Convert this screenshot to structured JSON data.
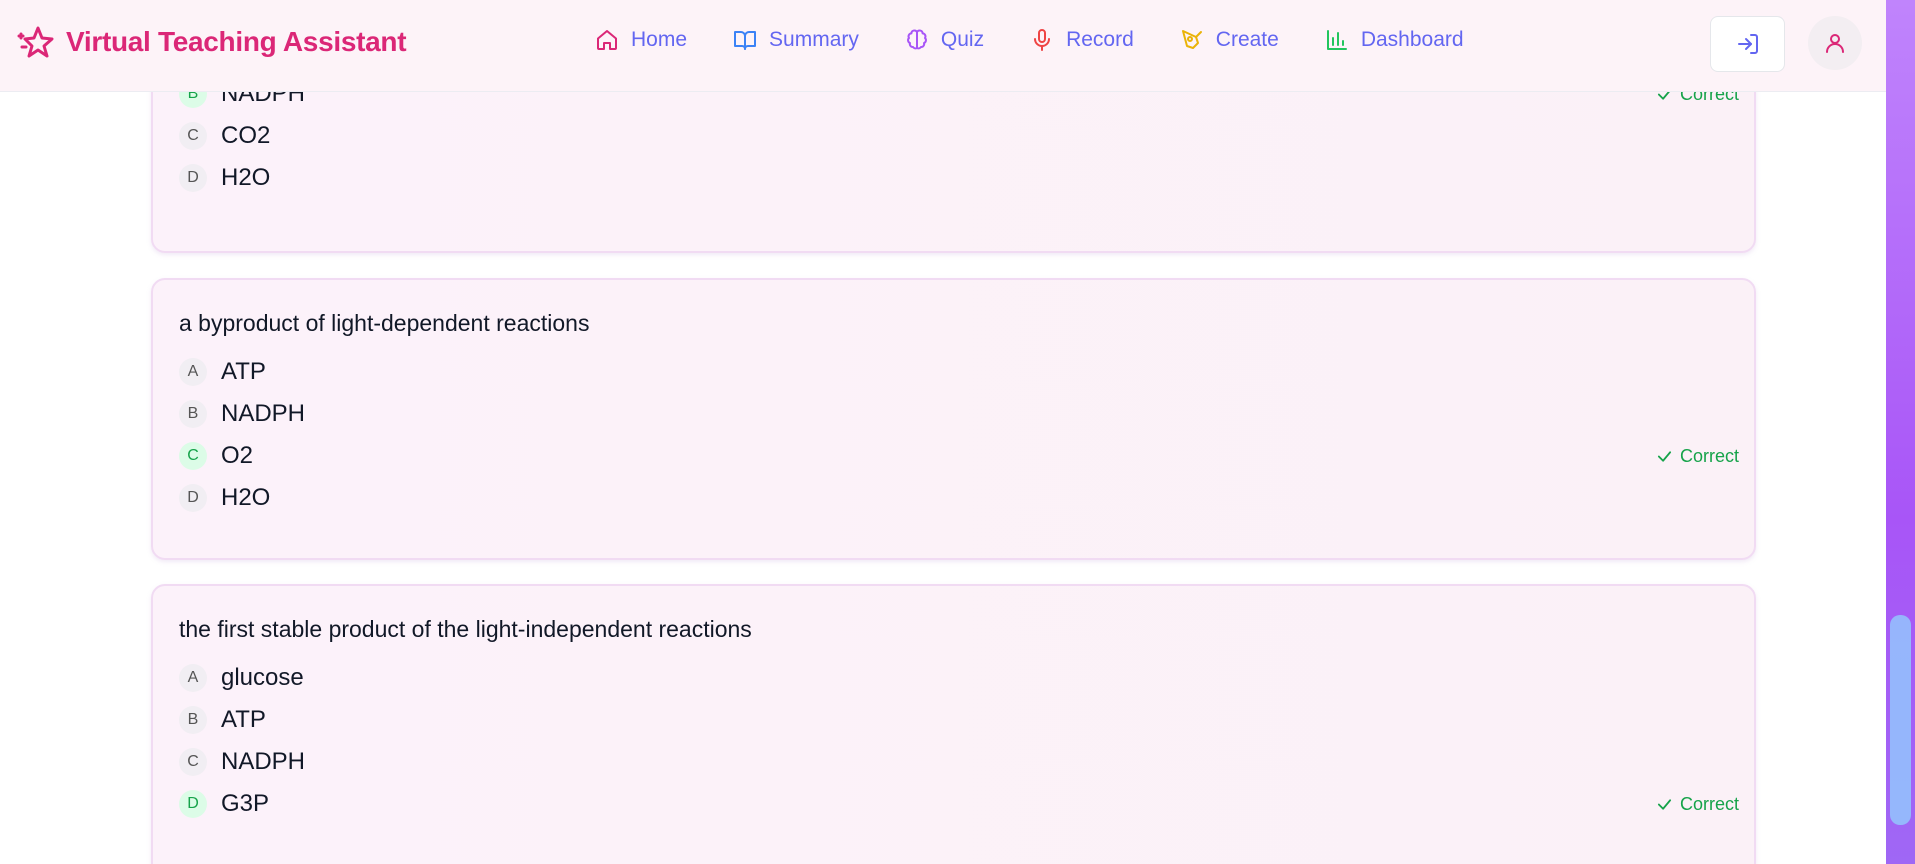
{
  "header": {
    "brand": "Virtual Teaching Assistant",
    "nav": [
      {
        "label": "Home",
        "icon": "home-icon",
        "color": "#db2777"
      },
      {
        "label": "Summary",
        "icon": "book-open-icon",
        "color": "#3b82f6"
      },
      {
        "label": "Quiz",
        "icon": "brain-icon",
        "color": "#a855f7"
      },
      {
        "label": "Record",
        "icon": "microphone-icon",
        "color": "#ef4444"
      },
      {
        "label": "Create",
        "icon": "pen-tool-icon",
        "color": "#eab308"
      },
      {
        "label": "Dashboard",
        "icon": "bar-chart-icon",
        "color": "#22c55e"
      }
    ],
    "login_icon": "log-in-icon",
    "user_icon": "user-icon"
  },
  "questions": [
    {
      "text": "",
      "options": [
        {
          "letter": "B",
          "text": "NADPH",
          "correct": true
        },
        {
          "letter": "C",
          "text": "CO2",
          "correct": false
        },
        {
          "letter": "D",
          "text": "H2O",
          "correct": false
        }
      ],
      "correct_label": "Correct"
    },
    {
      "text": "a byproduct of light-dependent reactions",
      "options": [
        {
          "letter": "A",
          "text": "ATP",
          "correct": false
        },
        {
          "letter": "B",
          "text": "NADPH",
          "correct": false
        },
        {
          "letter": "C",
          "text": "O2",
          "correct": true
        },
        {
          "letter": "D",
          "text": "H2O",
          "correct": false
        }
      ],
      "correct_label": "Correct"
    },
    {
      "text": "the first stable product of the light-independent reactions",
      "options": [
        {
          "letter": "A",
          "text": "glucose",
          "correct": false
        },
        {
          "letter": "B",
          "text": "ATP",
          "correct": false
        },
        {
          "letter": "C",
          "text": "NADPH",
          "correct": false
        },
        {
          "letter": "D",
          "text": "G3P",
          "correct": true
        }
      ],
      "correct_label": "Correct"
    }
  ],
  "colors": {
    "brand": "#db2777",
    "nav_text": "#6366f1",
    "correct": "#16a34a",
    "card_border": "#f1dbf3"
  }
}
